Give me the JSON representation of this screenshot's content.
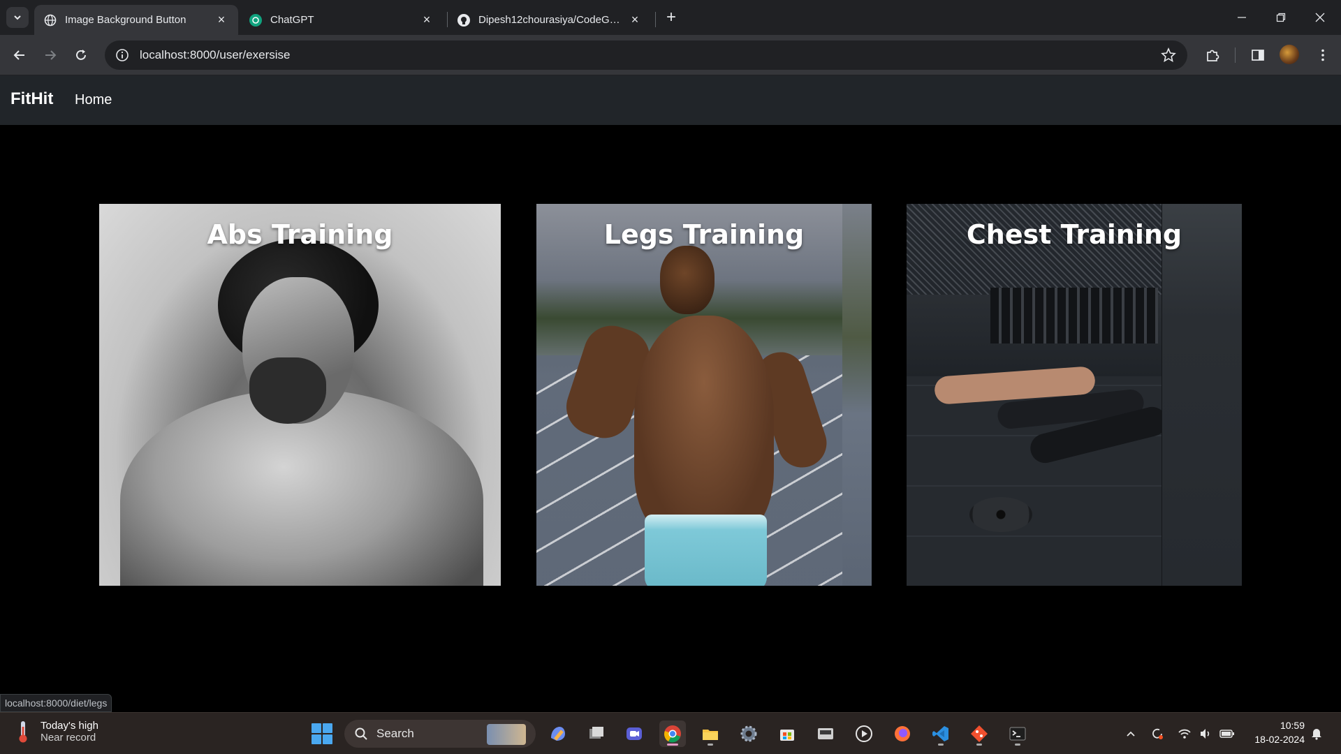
{
  "browser": {
    "tabs": [
      {
        "title": "Image Background Button",
        "active": true,
        "icon": "globe-icon"
      },
      {
        "title": "ChatGPT",
        "active": false,
        "icon": "chatgpt-icon"
      },
      {
        "title": "Dipesh12chourasiya/CodeGym:",
        "active": false,
        "icon": "github-icon"
      }
    ],
    "url": "localhost:8000/user/exersise",
    "status_url": "localhost:8000/diet/legs"
  },
  "site": {
    "brand": "FitHit",
    "nav": {
      "home": "Home"
    },
    "cards": [
      {
        "label": "Abs Training",
        "photo": "grayscale-portrait-shirtless-man"
      },
      {
        "label": "Legs Training",
        "photo": "sprinter-running-on-track"
      },
      {
        "label": "Chest Training",
        "photo": "group-push-ups-in-gym"
      }
    ]
  },
  "taskbar": {
    "weather_title": "Today's high",
    "weather_sub": "Near record",
    "search_label": "Search",
    "time": "10:59",
    "date": "18-02-2024",
    "apps": [
      "copilot-icon",
      "task-view-icon",
      "meet-icon",
      "chrome-icon",
      "file-explorer-icon",
      "settings-icon",
      "store-icon",
      "vm-icon",
      "media-player-icon",
      "firefox-icon",
      "vscode-icon",
      "git-icon",
      "terminal-icon"
    ]
  },
  "colors": {
    "navbar": "#212529",
    "page_bg": "#000000",
    "chrome_bg": "#202124",
    "toolbar_bg": "#35363a"
  }
}
